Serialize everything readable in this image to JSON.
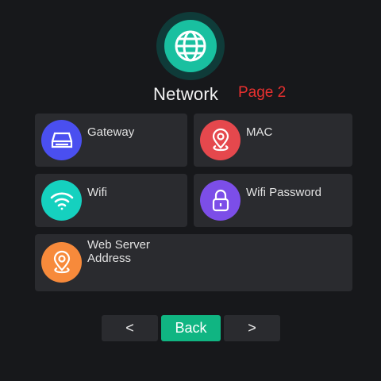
{
  "header": {
    "icon": "globe-icon",
    "title": "Network",
    "page_label": "Page 2"
  },
  "items": [
    {
      "label": "Gateway",
      "icon": "router-icon",
      "color": "#4a4ff0"
    },
    {
      "label": "MAC",
      "icon": "location-pin-icon",
      "color": "#e5484d"
    },
    {
      "label": "Wifi",
      "icon": "wifi-icon",
      "color": "#15d1bf"
    },
    {
      "label": "Wifi Password",
      "icon": "lock-icon",
      "color": "#7c4ee8"
    },
    {
      "label": "Web Server\nAddress",
      "icon": "location-pin-icon",
      "color": "#f78a3b"
    }
  ],
  "nav": {
    "prev_label": "<",
    "back_label": "Back",
    "next_label": ">"
  },
  "colors": {
    "background": "#17181b",
    "card": "#2a2b2f",
    "accent": "#10b582",
    "page_label": "#e8302f"
  }
}
